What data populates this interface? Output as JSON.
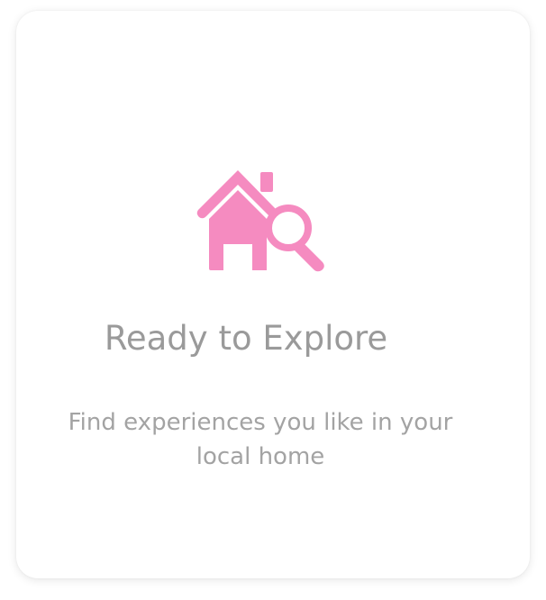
{
  "empty_state": {
    "icon": "house-search-icon",
    "title": "Ready to Explore",
    "message": "Find experiences you like in your local home"
  },
  "colors": {
    "icon": "#f58bc0",
    "title_text": "#9a9a9a",
    "message_text": "#a3a3a3",
    "card_background": "#ffffff"
  }
}
